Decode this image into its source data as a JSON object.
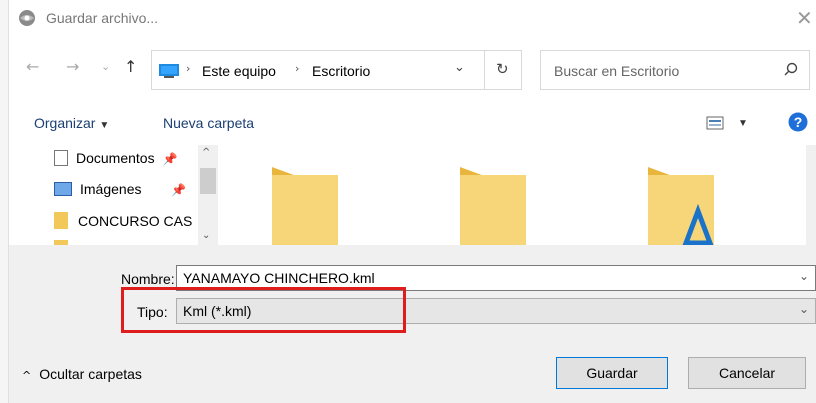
{
  "window": {
    "title": "Guardar archivo..."
  },
  "address": {
    "breadcrumb": [
      "Este equipo",
      "Escritorio"
    ],
    "search_placeholder": "Buscar en Escritorio"
  },
  "toolbar": {
    "organize_label": "Organizar",
    "new_folder_label": "Nueva carpeta"
  },
  "sidebar": {
    "items": [
      {
        "label": "Documentos",
        "icon": "document-icon",
        "pinned": true
      },
      {
        "label": "Imágenes",
        "icon": "image-icon",
        "pinned": true
      },
      {
        "label": "CONCURSO CAS",
        "icon": "folder-icon",
        "pinned": false
      }
    ]
  },
  "form": {
    "name_label": "Nombre:",
    "name_value": "YANAMAYO CHINCHERO.kml",
    "type_label": "Tipo:",
    "type_value": "Kml (*.kml)"
  },
  "footer": {
    "hide_folders_label": "Ocultar carpetas",
    "save_label": "Guardar",
    "cancel_label": "Cancelar"
  },
  "colors": {
    "accent": "#0078d7",
    "highlight": "#e01d1d",
    "folder": "#f3c85a"
  }
}
